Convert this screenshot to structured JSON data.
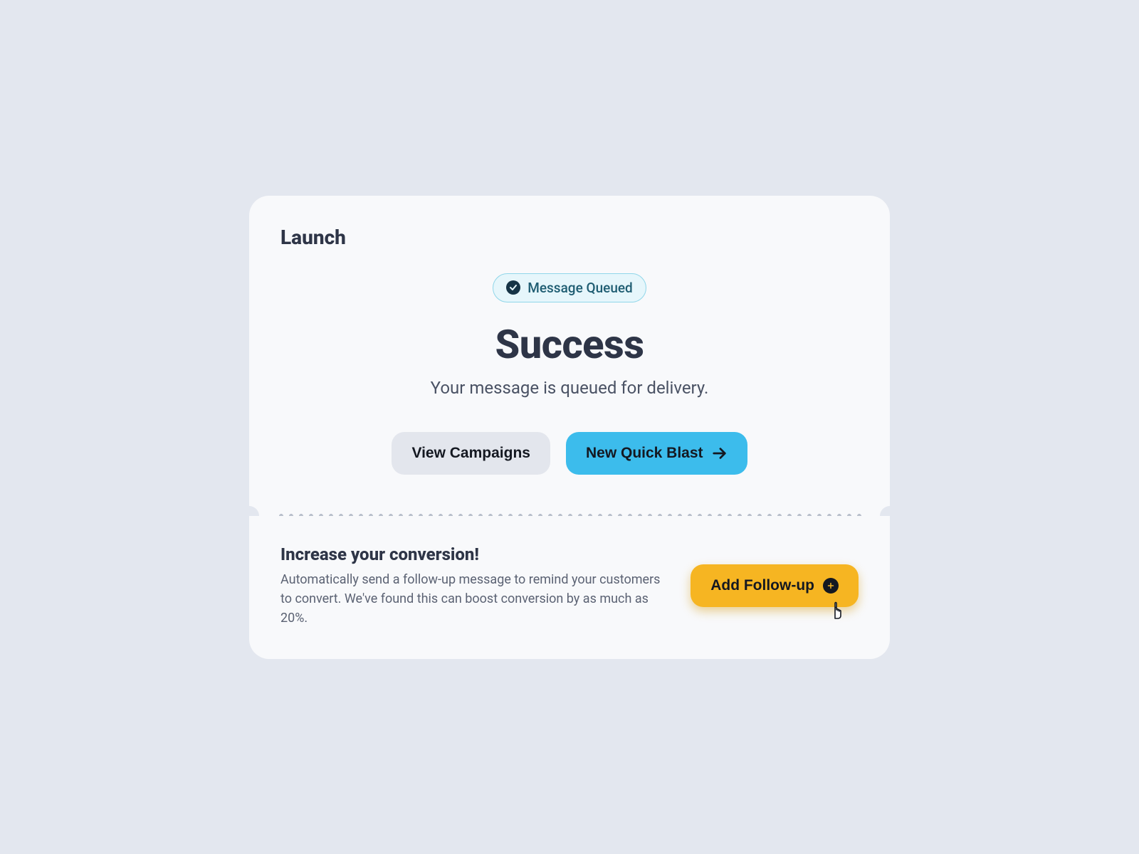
{
  "header": {
    "title": "Launch"
  },
  "status": {
    "label": "Message Queued"
  },
  "main": {
    "heading": "Success",
    "subtext": "Your message is queued for delivery."
  },
  "actions": {
    "view_campaigns": "View Campaigns",
    "new_quick_blast": "New Quick Blast"
  },
  "promo": {
    "title": "Increase your conversion!",
    "body": "Automatically send a follow-up message to remind your customers to convert. We've found this can boost conversion by as much as 20%.",
    "cta": "Add Follow-up"
  }
}
